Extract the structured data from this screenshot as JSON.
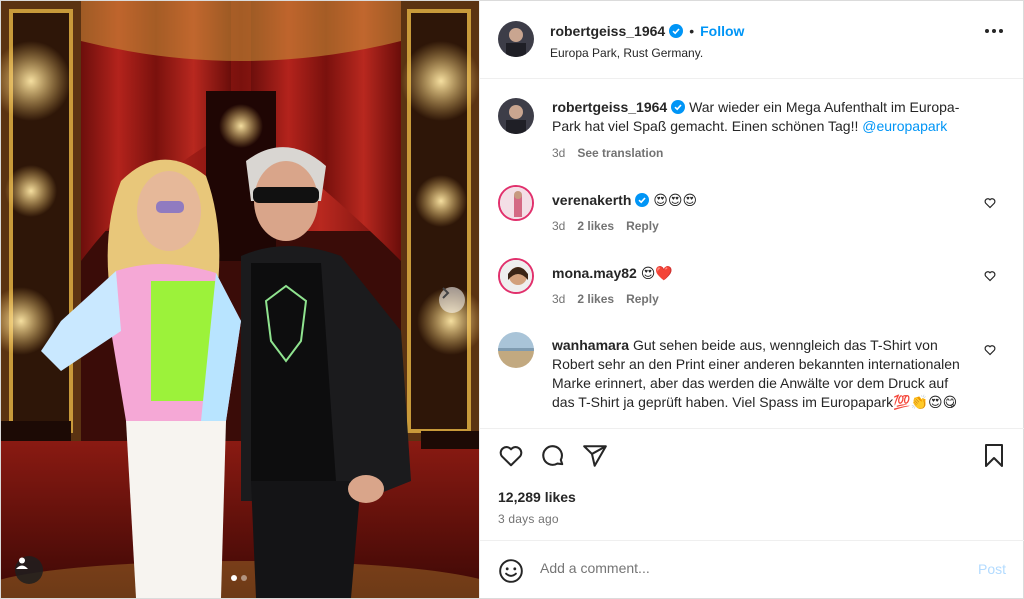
{
  "post": {
    "username": "robertgeiss_1964",
    "separator": "•",
    "follow_label": "Follow",
    "location": "Europa Park, Rust Germany.",
    "caption": {
      "username": "robertgeiss_1964",
      "text": "War wieder ein Mega Aufenthalt im Europa-Park hat viel Spaß gemacht. Einen schönen Tag!!",
      "mention": "@europapark",
      "age": "3d",
      "translate": "See translation"
    },
    "likes": "12,289 likes",
    "posted_ago": "3 days ago"
  },
  "comments": [
    {
      "username": "verenakerth",
      "text": "😍😍😍",
      "age": "3d",
      "likes": "2 likes",
      "reply": "Reply"
    },
    {
      "username": "mona.may82",
      "text": "😍❤️",
      "age": "3d",
      "likes": "2 likes",
      "reply": "Reply"
    },
    {
      "username": "wanhamara",
      "text": "Gut sehen beide aus, wenngleich das T-Shirt von Robert sehr an den Print einer anderen bekannten internationalen Marke erinnert, aber das werden die Anwälte vor dem Druck auf das T-Shirt ja geprüft haben. Viel Spass im Europapark💯👏😍😋"
    }
  ],
  "add_comment": {
    "placeholder": "Add a comment...",
    "post_label": "Post"
  },
  "icons": {
    "verified": "verified-badge-icon",
    "more": "more-options-icon",
    "like": "heart-icon",
    "comment": "comment-icon",
    "share": "send-icon",
    "save": "bookmark-icon",
    "emoji": "emoji-icon",
    "next": "chevron-right-icon",
    "tag": "user-tag-icon"
  },
  "colors": {
    "accent": "#0095f6",
    "muted": "#737373",
    "post_disabled": "#b3dbff"
  }
}
